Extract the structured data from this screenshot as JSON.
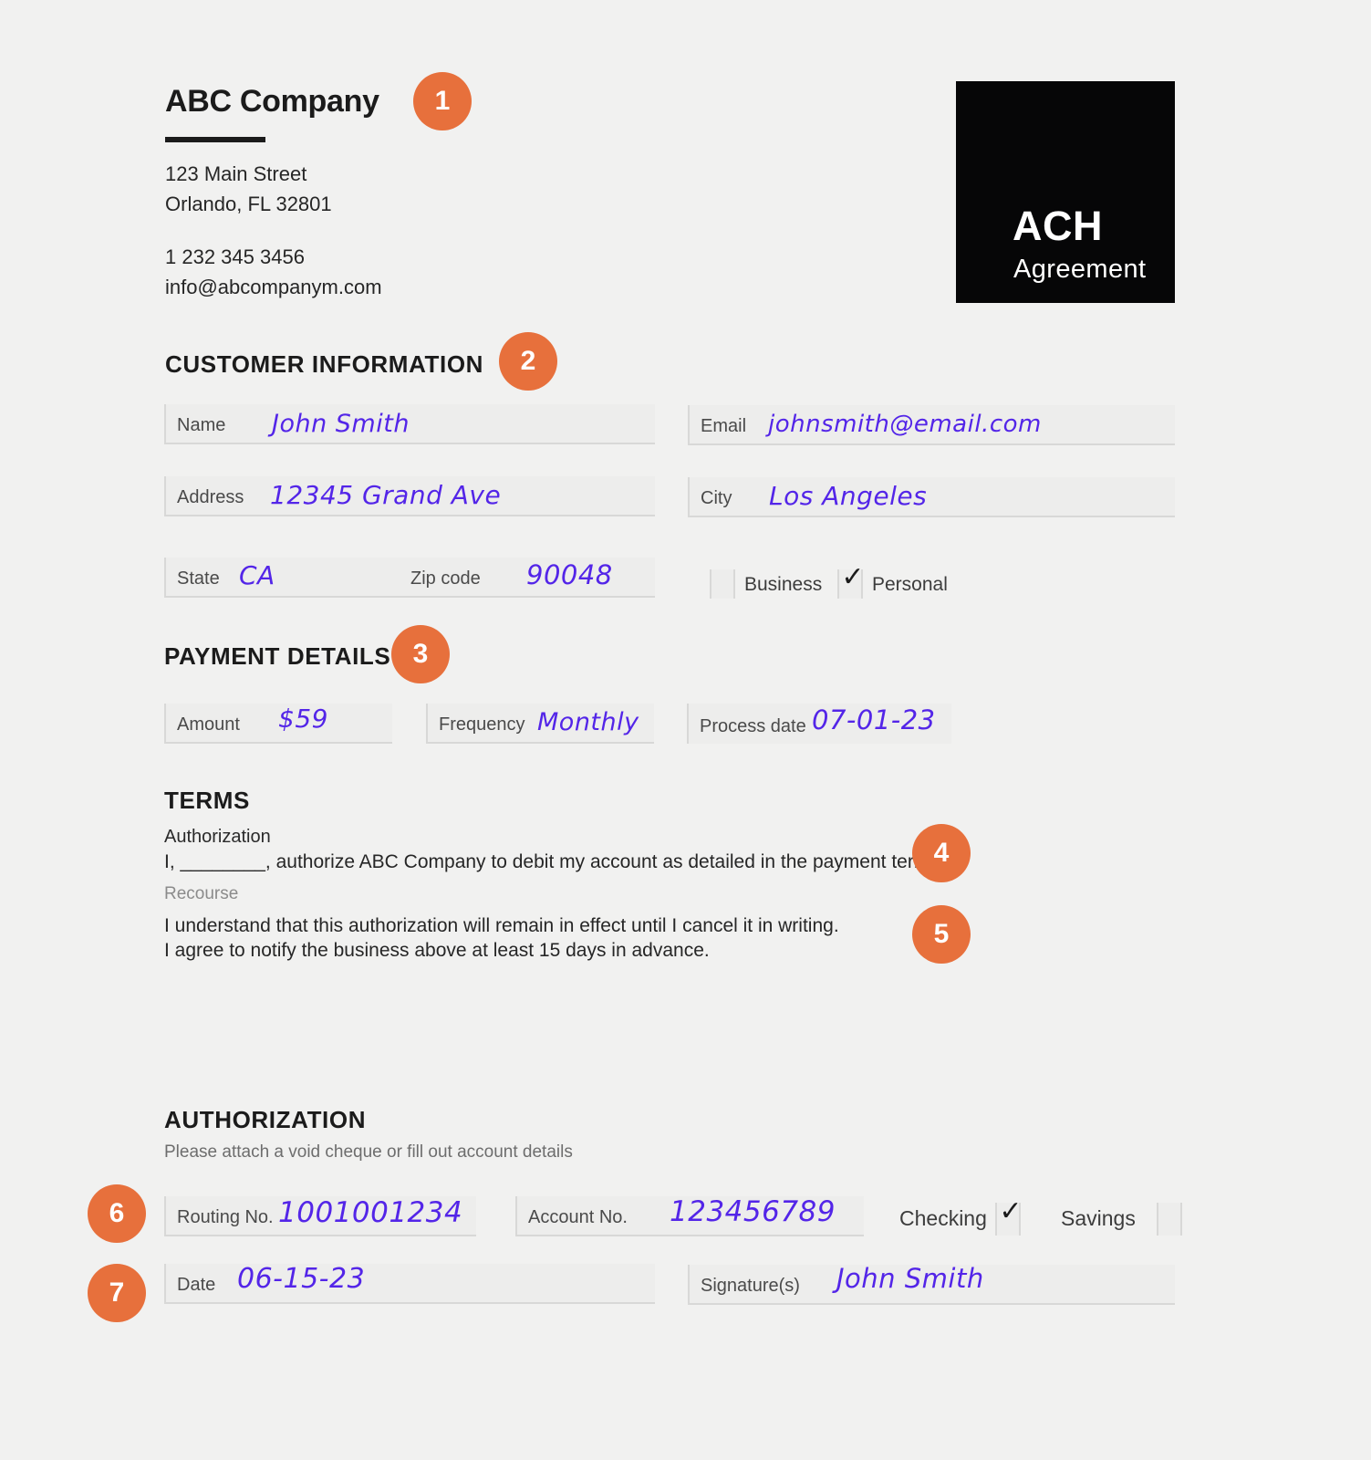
{
  "document": {
    "background_color": "#f1f1f0",
    "accent_color": "#e7703c",
    "handwriting_color": "#5325e8"
  },
  "header": {
    "company_name": "ABC Company",
    "address_line_1": "123 Main Street",
    "address_line_2": "Orlando, FL 32801",
    "phone": "1 232 345 3456",
    "email": "info@abcompanym.com"
  },
  "logo": {
    "primary": "ACH",
    "secondary": "Agreement"
  },
  "badges": [
    {
      "number": "1"
    },
    {
      "number": "2"
    },
    {
      "number": "3"
    },
    {
      "number": "4"
    },
    {
      "number": "5"
    },
    {
      "number": "6"
    },
    {
      "number": "7"
    }
  ],
  "customer_information": {
    "title": "CUSTOMER INFORMATION",
    "fields": {
      "name": {
        "label": "Name",
        "value": "John Smith"
      },
      "email": {
        "label": "Email",
        "value": "johnsmith@email.com"
      },
      "address": {
        "label": "Address",
        "value": "12345 Grand Ave"
      },
      "city": {
        "label": "City",
        "value": "Los Angeles"
      },
      "state": {
        "label": "State",
        "value": "CA"
      },
      "zip_code": {
        "label": "Zip code",
        "value": "90048"
      }
    },
    "account_type": {
      "business": {
        "label": "Business",
        "checked": false,
        "mark": ""
      },
      "personal": {
        "label": "Personal",
        "checked": true,
        "mark": "✓"
      }
    }
  },
  "payment_details": {
    "title": "PAYMENT DETAILS",
    "fields": {
      "amount": {
        "label": "Amount",
        "value": "$59"
      },
      "frequency": {
        "label": "Frequency",
        "value": "Monthly"
      },
      "process_date": {
        "label": "Process date",
        "value": "07-01-23"
      }
    }
  },
  "terms": {
    "title": "TERMS",
    "authorization_label": "Authorization",
    "authorization_text": "I, ________, authorize ABC Company to debit my account as detailed in the payment terms.",
    "recourse_label": "Recourse",
    "recourse_line_1": "I understand that this authorization will remain in effect until I cancel it in writing.",
    "recourse_line_2": "I agree to notify the business above at least 15 days in advance."
  },
  "authorization": {
    "title": "AUTHORIZATION",
    "subtitle": "Please attach a void cheque or fill out account details",
    "fields": {
      "routing_no": {
        "label": "Routing No.",
        "value": "1001001234"
      },
      "account_no": {
        "label": "Account No.",
        "value": "123456789"
      },
      "date": {
        "label": "Date",
        "value": "06-15-23"
      },
      "signature": {
        "label": "Signature(s)",
        "value": "John Smith"
      }
    },
    "account_kind": {
      "checking": {
        "label": "Checking",
        "checked": true,
        "mark": "✓"
      },
      "savings": {
        "label": "Savings",
        "checked": false,
        "mark": ""
      }
    }
  }
}
